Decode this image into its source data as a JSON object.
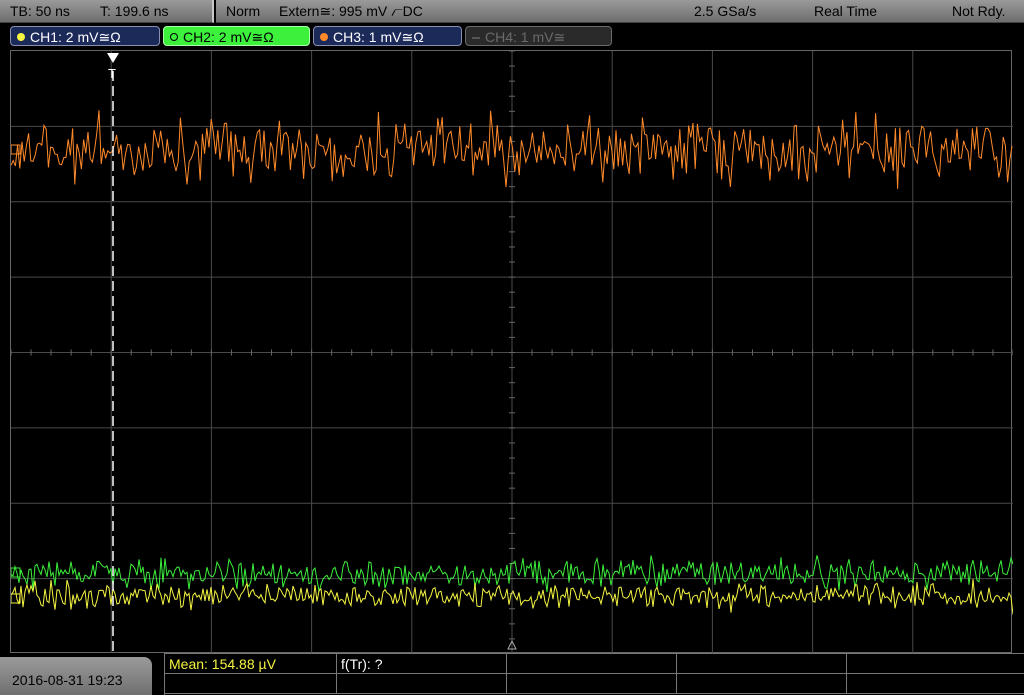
{
  "header": {
    "timebase": "TB: 50 ns",
    "trigger_time": "T: 199.6 ns",
    "mode": "Norm",
    "trigger_source": "Extern≅: 995 mV ⦧DC",
    "sample_rate": "2.5 GSa/s",
    "acq_mode": "Real Time",
    "status": "Not Rdy."
  },
  "channels": [
    {
      "label": "CH1: 2 mV≅Ω",
      "color": "#f5f542"
    },
    {
      "label": "CH2: 2 mV≅Ω",
      "color": "#3cf03c"
    },
    {
      "label": "CH3: 1 mV≅Ω",
      "color": "#ff8a2a"
    },
    {
      "label": "CH4: 1 mV≅",
      "color": "#555555"
    }
  ],
  "trigger_marker": "T",
  "footer": {
    "datetime": "2016-08-31 19:23",
    "mean": "Mean: 154.88 µV",
    "freq": "f(Tr): ?"
  },
  "colors": {
    "ch1": "#f5f542",
    "ch2": "#3cf03c",
    "ch3": "#ff8a2a",
    "grid": "#4a4a4a",
    "meas_text": "#f5f542"
  }
}
